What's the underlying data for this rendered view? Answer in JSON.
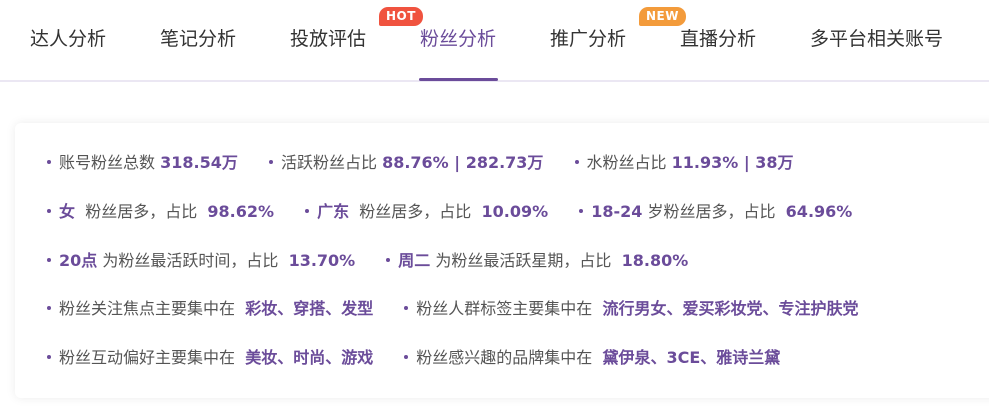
{
  "tabs": {
    "t1": "达人分析",
    "t2": "笔记分析",
    "t3": "投放评估",
    "t4": "粉丝分析",
    "t5": "推广分析",
    "t6": "直播分析",
    "t7": "多平台相关账号",
    "hot_badge": "HOT",
    "new_badge": "NEW",
    "active": "粉丝分析"
  },
  "stats": {
    "r1": {
      "a_label": "账号粉丝总数",
      "a_value": "318.54万",
      "b_label": "活跃粉丝占比",
      "b_value": "88.76% | 282.73万",
      "c_label": "水粉丝占比",
      "c_value": "11.93% | 38万"
    },
    "r2": {
      "a_value": "女",
      "a_label": "粉丝居多，占比",
      "a_pct": "98.62%",
      "b_value": "广东",
      "b_label": "粉丝居多，占比",
      "b_pct": "10.09%",
      "c_value": "18-24",
      "c_label": "岁粉丝居多，占比",
      "c_pct": "64.96%"
    },
    "r3": {
      "a_value": "20点",
      "a_label": "为粉丝最活跃时间，占比",
      "a_pct": "13.70%",
      "b_value": "周二",
      "b_label": "为粉丝最活跃星期，占比",
      "b_pct": "18.80%"
    },
    "r4": {
      "a_label": "粉丝关注焦点主要集中在",
      "a_value": "彩妆、穿搭、发型",
      "b_label": "粉丝人群标签主要集中在",
      "b_value": "流行男女、爱买彩妆党、专注护肤党"
    },
    "r5": {
      "a_label": "粉丝互动偏好主要集中在",
      "a_value": "美妆、时尚、游戏",
      "b_label": "粉丝感兴趣的品牌集中在",
      "b_value": "黛伊泉、3CE、雅诗兰黛"
    }
  },
  "colors": {
    "accent": "#6b4c9a",
    "hot": "#f0533f",
    "new": "#f39b3b"
  }
}
